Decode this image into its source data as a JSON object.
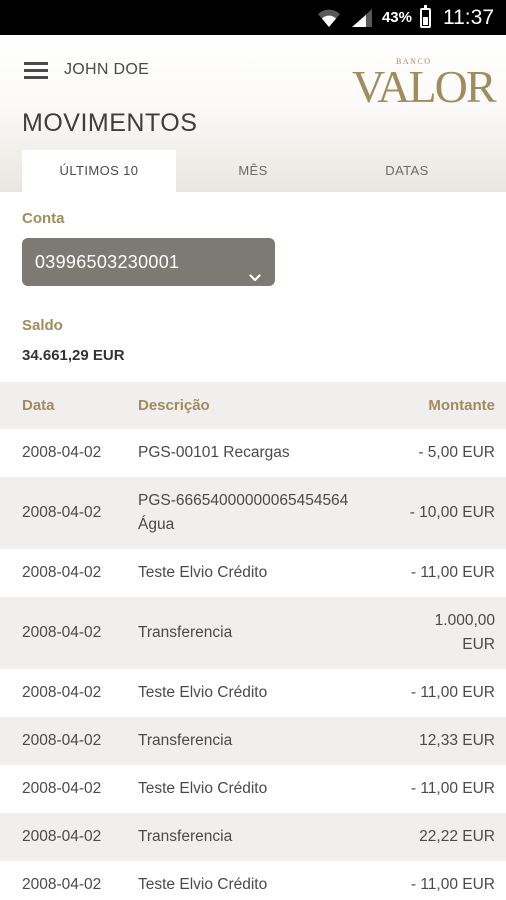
{
  "status_bar": {
    "battery_percent": "43%",
    "time": "11:37",
    "icons": [
      "wifi-icon",
      "signal-icon",
      "battery-icon"
    ]
  },
  "header": {
    "user_name": "JOHN DOE",
    "logo_small": "BANCO",
    "logo_main": "VALOR",
    "page_title": "MOVIMENTOS"
  },
  "tabs": [
    {
      "label": "ÚLTIMOS 10",
      "active": true
    },
    {
      "label": "MÊS",
      "active": false
    },
    {
      "label": "DATAS",
      "active": false
    }
  ],
  "account": {
    "label": "Conta",
    "selected": "03996503230001"
  },
  "balance": {
    "label": "Saldo",
    "value": "34.661,29 EUR"
  },
  "table": {
    "headers": {
      "date": "Data",
      "description": "Descrição",
      "amount": "Montante"
    },
    "rows": [
      {
        "date": "2008-04-02",
        "description": "PGS-00101 Recargas",
        "amount": "- 5,00 EUR"
      },
      {
        "date": "2008-04-02",
        "description": "PGS-66654000000065454564 Água",
        "amount": "- 10,00 EUR"
      },
      {
        "date": "2008-04-02",
        "description": "Teste Elvio Crédito",
        "amount": "- 11,00 EUR"
      },
      {
        "date": "2008-04-02",
        "description": "Transferencia",
        "amount": "1.000,00 EUR"
      },
      {
        "date": "2008-04-02",
        "description": "Teste Elvio Crédito",
        "amount": "- 11,00 EUR"
      },
      {
        "date": "2008-04-02",
        "description": "Transferencia",
        "amount": "12,33 EUR"
      },
      {
        "date": "2008-04-02",
        "description": "Teste Elvio Crédito",
        "amount": "- 11,00 EUR"
      },
      {
        "date": "2008-04-02",
        "description": "Transferencia",
        "amount": "22,22 EUR"
      },
      {
        "date": "2008-04-02",
        "description": "Teste Elvio Crédito",
        "amount": "- 11,00 EUR"
      }
    ]
  },
  "colors": {
    "gold": "#a08c5c",
    "select_bg": "#7d7a73",
    "row_alt": "#f0efed"
  }
}
